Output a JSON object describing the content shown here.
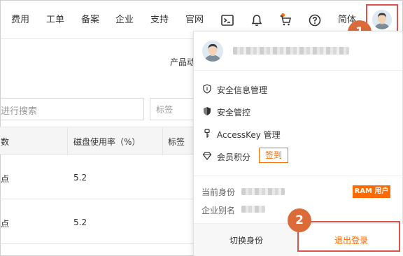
{
  "nav": {
    "items": [
      "费用",
      "工单",
      "备案",
      "企业",
      "支持",
      "官网"
    ],
    "lang": "简体",
    "icons": [
      "terminal-icon",
      "bell-icon",
      "cart-icon",
      "help-icon"
    ]
  },
  "console": {
    "product_label": "产品动",
    "search_placeholder": "进行搜索",
    "tag_placeholder": "标签",
    "columns": [
      "数",
      "磁盘使用率（%）",
      "标签"
    ],
    "rows": [
      {
        "c0": "点",
        "disk": "5.2"
      },
      {
        "c0": "点",
        "disk": "5.2"
      }
    ]
  },
  "dropdown": {
    "menu": [
      {
        "label": "安全信息管理",
        "icon": "shield-icon"
      },
      {
        "label": "安全管控",
        "icon": "shield-filled-icon"
      },
      {
        "label": "AccessKey 管理",
        "icon": "key-icon"
      },
      {
        "label": "会员积分",
        "icon": "diamond-icon"
      }
    ],
    "signin_label": "签到",
    "current_identity_label": "当前身份",
    "ram_badge": "RAM 用户",
    "enterprise_alias_label": "企业别名",
    "switch_identity": "切换身份",
    "logout": "退出登录"
  },
  "steps": [
    "1",
    "2"
  ],
  "colors": {
    "accent": "#ff6a00",
    "highlight": "#d9534f",
    "step": "#dc6b3a"
  }
}
